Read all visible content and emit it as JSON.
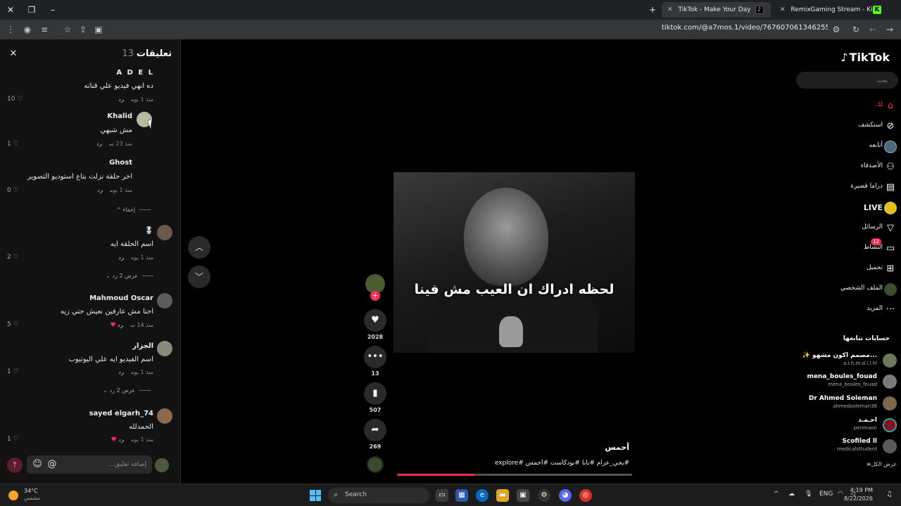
{
  "browser": {
    "tabs": [
      {
        "title": "TikTok - Make Your Day",
        "active": true
      },
      {
        "title": "RemixGaming Stream - Kick Da",
        "active": false
      }
    ],
    "url": "tiktok.com/@a7mos.1/video/7676070613462551829"
  },
  "comments_panel": {
    "title": "تعليقات",
    "count": "13",
    "input_placeholder": "إضافة تعليق...",
    "comments": [
      {
        "name": "A D E L",
        "text": "ده انهي فيديو علي قناته",
        "time": "منذ 1 يوم",
        "reply": "رد",
        "likes": "10"
      },
      {
        "name": "Khalid",
        "text": "مش شبهي",
        "time": "منذ 23 س",
        "reply": "رد",
        "likes": "1"
      },
      {
        "name": "Ghost",
        "text": "اخر حلقة نزلت بتاع استوديو التصوير",
        "time": "منذ 1 يوم",
        "reply": "رد",
        "likes": "0"
      },
      {
        "name": "🎖",
        "text": "اسم الحلقة ايه",
        "time": "منذ 1 يوم",
        "reply": "رد",
        "likes": "2"
      },
      {
        "name": "Mahmoud Oscar",
        "text": "احنا مش عارفين نعيش حتي زيه",
        "time": "منذ 14 س",
        "reply": "رد",
        "likes": "5"
      },
      {
        "name": "الجزار",
        "text": "اسم الفيديو ايه علي اليوتيوب",
        "time": "منذ 1 يوم",
        "reply": "رد",
        "likes": "1"
      },
      {
        "name": "sayed elgarh_74",
        "text": "الحمدلله",
        "time": "منذ 1 يوم",
        "reply": "رد",
        "likes": "1"
      }
    ],
    "hide_label": "إخفاء",
    "show_replies_1": "عرض 2 رد",
    "show_replies_2": "عرض 2 رد"
  },
  "video": {
    "caption": "لحظه ادراك ان العيب مش فينا",
    "author": "أحمس",
    "hashtags": "#يحي_عزام #بابا #بودكاست #احمس #explore",
    "progress": 0.33
  },
  "actions": {
    "likes": "2028",
    "comments": "13",
    "saves": "507",
    "shares": "269"
  },
  "sidebar": {
    "logo": "TikTok",
    "search_placeholder": "بحث",
    "nav": [
      {
        "label": "لك",
        "icon": "home-icon",
        "active": true
      },
      {
        "label": "استكشف",
        "icon": "compass-icon"
      },
      {
        "label": "أتابعه",
        "icon": "following-icon"
      },
      {
        "label": "الأصدقاء",
        "icon": "friends-icon"
      },
      {
        "label": "دراما قصيرة",
        "icon": "drama-icon"
      },
      {
        "label": "LIVE",
        "icon": "live-icon"
      },
      {
        "label": "الرسائل",
        "icon": "messages-icon"
      },
      {
        "label": "النشاط",
        "icon": "activity-icon",
        "badge": "12"
      },
      {
        "label": "تحميل",
        "icon": "upload-icon"
      },
      {
        "label": "الملف الشخصي",
        "icon": "profile-icon"
      },
      {
        "label": "المزيد",
        "icon": "more-icon"
      }
    ],
    "following_title": "حسابات تتابعها",
    "following": [
      {
        "name": "✨ مصمم اكون مشهو...",
        "handle": "a.l.h.m.d.l.l.hl"
      },
      {
        "name": "mena_boules_fouad",
        "handle": "mena_boules_fouad"
      },
      {
        "name": "Dr Ahmed Soleman",
        "handle": "ahmedsoleman38"
      },
      {
        "name": "احـمـد",
        "handle": "perimaon"
      },
      {
        "name": "Scofiled ll",
        "handle": "medicalsttudent"
      }
    ],
    "see_all": "عرض الكل"
  },
  "taskbar": {
    "temp": "34°C",
    "condition": "مشمس",
    "search_label": "Search",
    "lang": "ENG",
    "time": "4:19 PM",
    "date": "8/22/2026"
  }
}
